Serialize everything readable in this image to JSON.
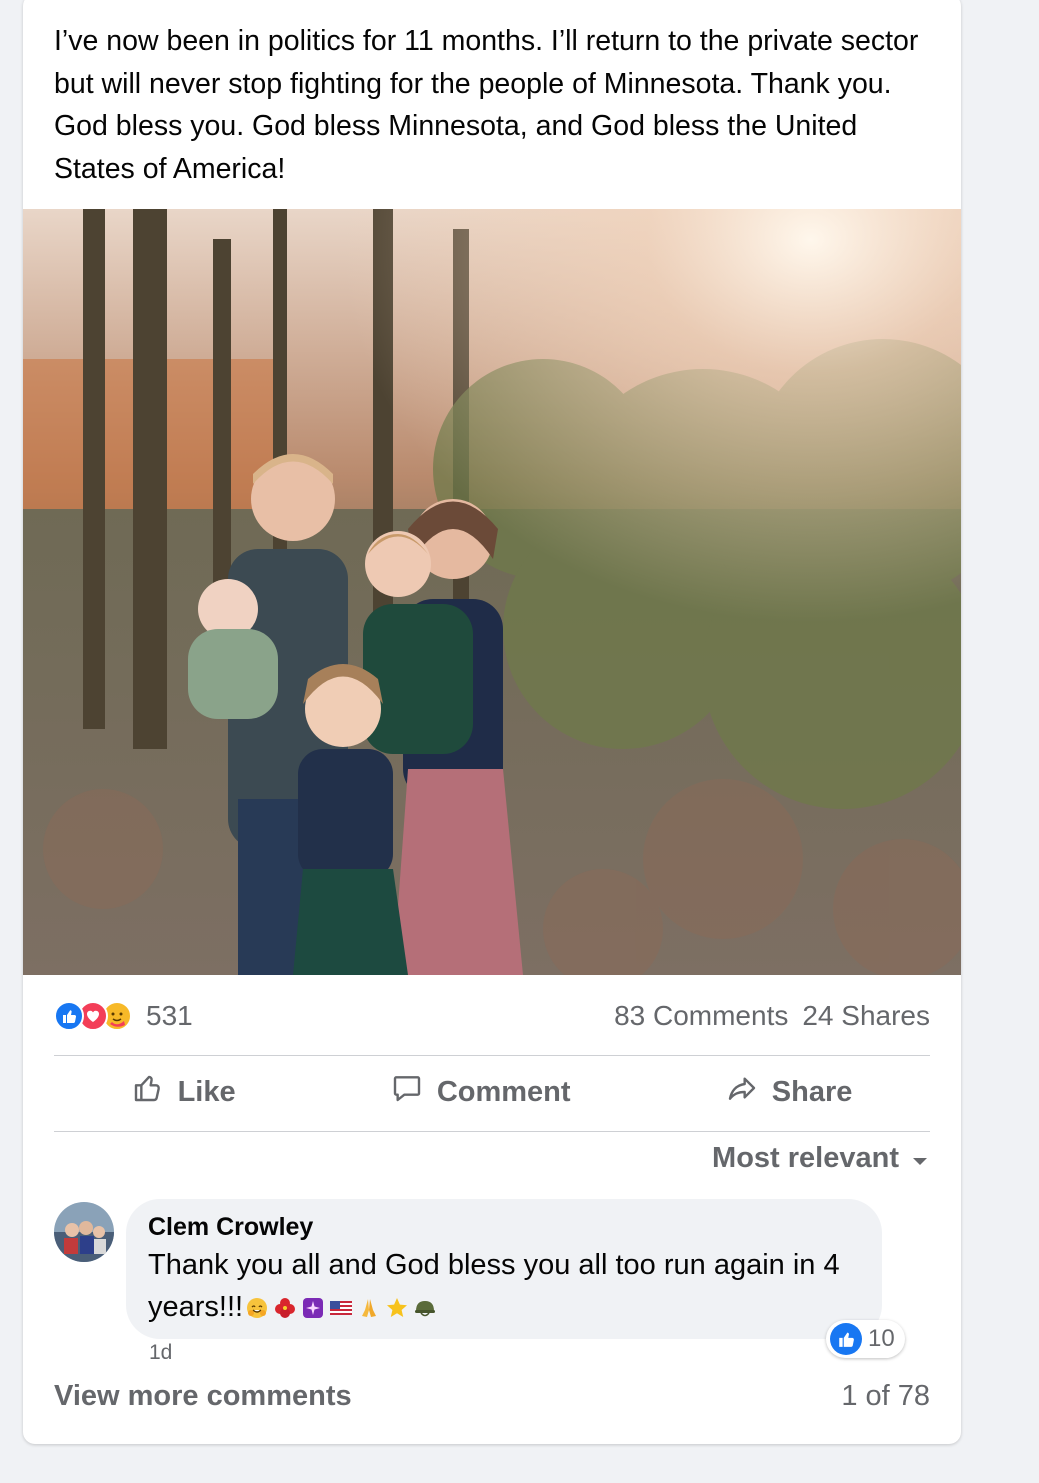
{
  "post": {
    "text": "I’ve now been in politics for 11 months. I’ll return to the private sector but will never stop fighting for the people of Minnesota. Thank you. God bless you. God bless Minnesota, and God bless the United States of America!"
  },
  "stats": {
    "reaction_icons": [
      "like-icon",
      "love-icon",
      "care-icon"
    ],
    "reaction_count": "531",
    "comments": "83 Comments",
    "shares": "24 Shares"
  },
  "actions": {
    "like": "Like",
    "comment": "Comment",
    "share": "Share"
  },
  "sort": {
    "label": "Most relevant"
  },
  "comment": {
    "author": "Clem Crowley",
    "text": "Thank you all and God bless you all too run again in 4 years!!!",
    "emojis": [
      "hugging-face",
      "hibiscus",
      "purple-sparkle",
      "us-flag",
      "folded-hands",
      "star",
      "military-helmet"
    ],
    "time": "1d",
    "likes": "10"
  },
  "footer": {
    "view_more": "View more comments",
    "pager": "1 of 78"
  },
  "colors": {
    "accent": "#1877f2",
    "love": "#f33e58",
    "secondary_text": "#65676b",
    "bubble": "#f0f2f5"
  }
}
